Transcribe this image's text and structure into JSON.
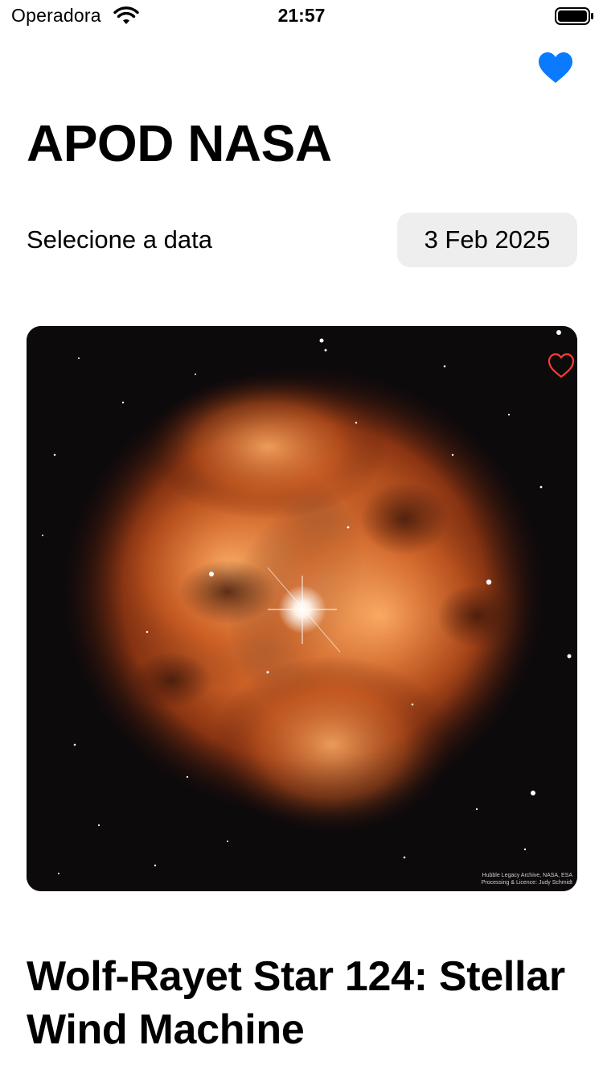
{
  "status_bar": {
    "carrier": "Operadora",
    "time": "21:57",
    "wifi_icon": "wifi-icon",
    "battery_icon": "battery-icon"
  },
  "nav": {
    "favorites_icon": "heart-filled-icon",
    "favorites_color": "#0a7aff"
  },
  "page": {
    "title": "APOD NASA"
  },
  "date_picker": {
    "label": "Selecione a data",
    "value": "3 Feb 2025"
  },
  "apod": {
    "image_credit_line1": "Hubble Legacy Archive, NASA, ESA",
    "image_credit_line2": "Processing & Licence: Judy Schmidt",
    "favorite_icon": "heart-outline-icon",
    "favorite_color": "#ff3b30",
    "title": "Wolf-Rayet Star 124: Stellar Wind Machine"
  }
}
